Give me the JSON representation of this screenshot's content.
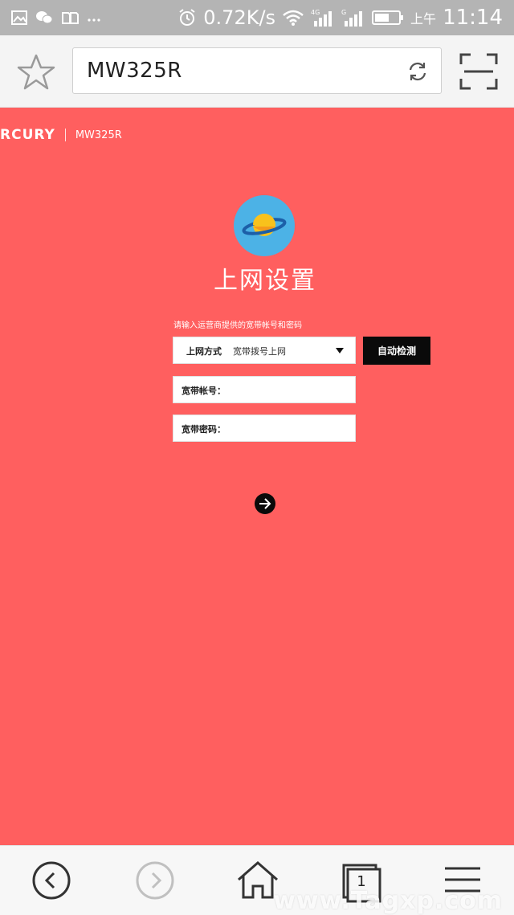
{
  "status_bar": {
    "network_speed": "0.72K/s",
    "am_pm": "上午",
    "time": "11:14",
    "icons": [
      "gallery-icon",
      "wechat-icon",
      "sim-icon",
      "more-icon",
      "alarm-icon",
      "wifi-icon",
      "signal-4g-icon",
      "signal-g-icon",
      "battery-icon"
    ]
  },
  "browser": {
    "url": "MW325R",
    "icons": [
      "star-icon",
      "refresh-icon",
      "scan-icon"
    ]
  },
  "page": {
    "brand_logo": "RCURY",
    "brand_model": "MW325R",
    "title": "上网设置",
    "hint": "请输入运营商提供的宽带帐号和密码",
    "connection_label": "上网方式",
    "connection_value": "宽带拨号上网",
    "auto_detect_label": "自动检测",
    "account_label": "宽带帐号：",
    "account_value": "",
    "password_label": "宽带密码：",
    "password_value": ""
  },
  "bottom_nav": {
    "tab_count": "1",
    "icons": [
      "back-icon",
      "forward-icon",
      "home-icon",
      "tabs-icon",
      "menu-icon"
    ]
  },
  "watermark": "www.Tagxp.com",
  "colors": {
    "page_background": "#ff5f5f",
    "button_black": "#0a0a0a",
    "planet_circle": "#4cb2e6",
    "planet_body": "#f8c21c"
  }
}
